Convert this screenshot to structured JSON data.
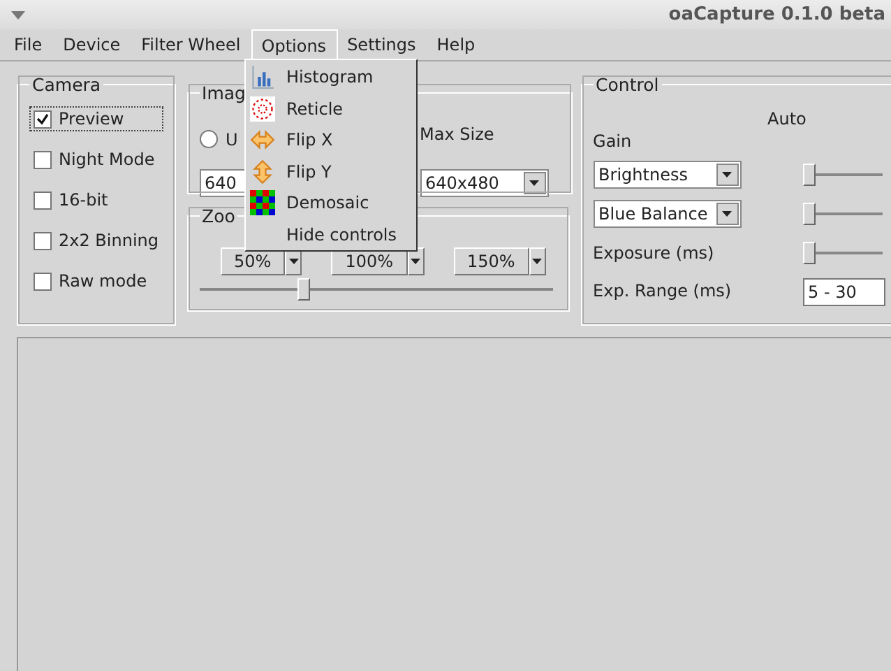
{
  "window": {
    "title": "oaCapture 0.1.0 beta"
  },
  "menu_bar": [
    {
      "label": "File",
      "selected": false
    },
    {
      "label": "Device",
      "selected": false
    },
    {
      "label": "Filter Wheel",
      "selected": false
    },
    {
      "label": "Options",
      "selected": true
    },
    {
      "label": "Settings",
      "selected": false
    },
    {
      "label": "Help",
      "selected": false
    }
  ],
  "options_menu": [
    {
      "label": "Histogram",
      "kind": "histogram"
    },
    {
      "label": "Reticle",
      "kind": "reticle"
    },
    {
      "label": "Flip X",
      "kind": "flipx"
    },
    {
      "label": "Flip Y",
      "kind": "flipy"
    },
    {
      "label": "Demosaic",
      "kind": "demosaic"
    },
    {
      "label": "Hide controls",
      "kind": "plain"
    }
  ],
  "camera": {
    "title": "Camera",
    "options": [
      {
        "label": "Preview",
        "checked": true,
        "focused": true
      },
      {
        "label": "Night Mode",
        "checked": false,
        "focused": false
      },
      {
        "label": "16-bit",
        "checked": false,
        "focused": false
      },
      {
        "label": "2x2 Binning",
        "checked": false,
        "focused": false
      },
      {
        "label": "Raw mode",
        "checked": false,
        "focused": false
      }
    ]
  },
  "image": {
    "title": "Imag",
    "radio": {
      "label": "U",
      "selected": false
    },
    "size_label": "Max Size",
    "size_combo": "640",
    "max_combo": "640x480"
  },
  "zoom": {
    "title": "Zoo",
    "buttons": [
      "50%",
      "100%",
      "150%"
    ],
    "slider": {
      "level": 0.28
    }
  },
  "control": {
    "title": "Control",
    "auto_label": "Auto",
    "gain_label": "Gain",
    "rows": [
      {
        "kind": "combo",
        "value": "Brightness",
        "level": 0
      },
      {
        "kind": "combo",
        "value": "Blue Balance",
        "level": 0
      },
      {
        "kind": "label",
        "label": "Exposure (ms)",
        "level": 0
      },
      {
        "kind": "range",
        "label": "Exp. Range (ms)",
        "value": "5 - 30"
      }
    ]
  }
}
